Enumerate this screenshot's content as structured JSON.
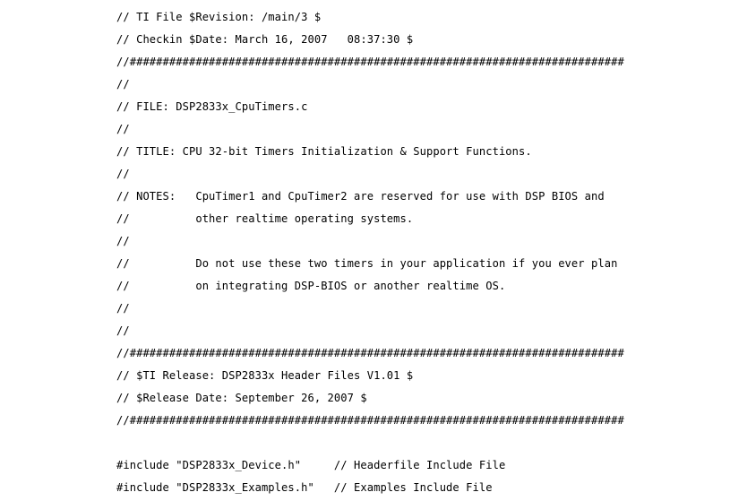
{
  "document": {
    "kind": "source-code-text",
    "language": "C",
    "file_name": "DSP2833x_CpuTimers.c",
    "background_color": "#ffffff",
    "text_color": "#000000",
    "lines": [
      "// TI File $Revision: /main/3 $",
      "// Checkin $Date: March 16, 2007   08:37:30 $",
      "//###########################################################################",
      "//",
      "// FILE: DSP2833x_CpuTimers.c",
      "//",
      "// TITLE: CPU 32-bit Timers Initialization & Support Functions.",
      "//",
      "// NOTES:   CpuTimer1 and CpuTimer2 are reserved for use with DSP BIOS and",
      "//          other realtime operating systems.",
      "//",
      "//          Do not use these two timers in your application if you ever plan",
      "//          on integrating DSP-BIOS or another realtime OS.",
      "//",
      "//",
      "//###########################################################################",
      "// $TI Release: DSP2833x Header Files V1.01 $",
      "// $Release Date: September 26, 2007 $",
      "//###########################################################################",
      "",
      "#include \"DSP2833x_Device.h\"     // Headerfile Include File",
      "#include \"DSP2833x_Examples.h\"   // Examples Include File"
    ]
  }
}
